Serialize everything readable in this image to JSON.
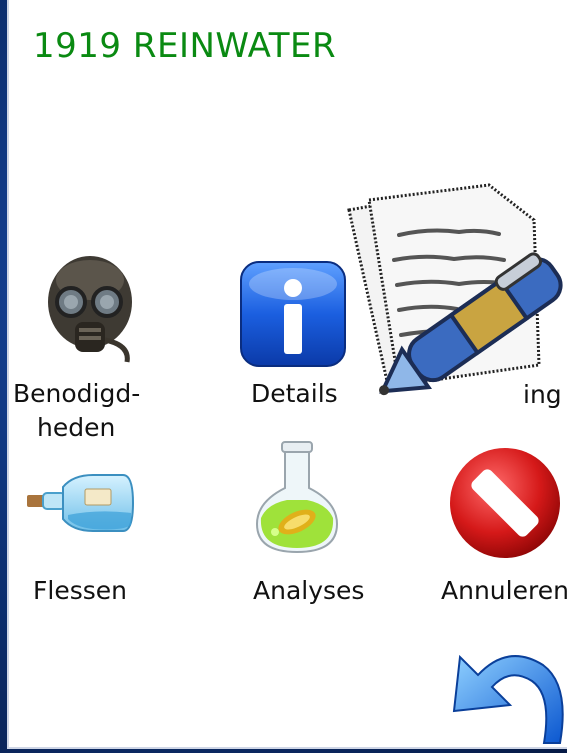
{
  "app": {
    "title": "1919 REINWATER"
  },
  "menu": {
    "items": [
      {
        "id": "benodigdheden",
        "label_line1": "Benodigd-",
        "label_line2": "heden",
        "icon": "gas-mask-icon"
      },
      {
        "id": "details",
        "label": "Details",
        "icon": "info-icon"
      },
      {
        "id": "opmerking",
        "label": "ing",
        "icon": "notes-pen-icon"
      },
      {
        "id": "flessen",
        "label": "Flessen",
        "icon": "bottle-icon"
      },
      {
        "id": "analyses",
        "label": "Analyses",
        "icon": "flask-icon"
      },
      {
        "id": "annuleren",
        "label": "Annuleren",
        "icon": "cancel-icon"
      }
    ],
    "back_icon": "back-arrow-icon"
  },
  "colors": {
    "title": "#0a8a12",
    "background": "#0b2a63"
  }
}
